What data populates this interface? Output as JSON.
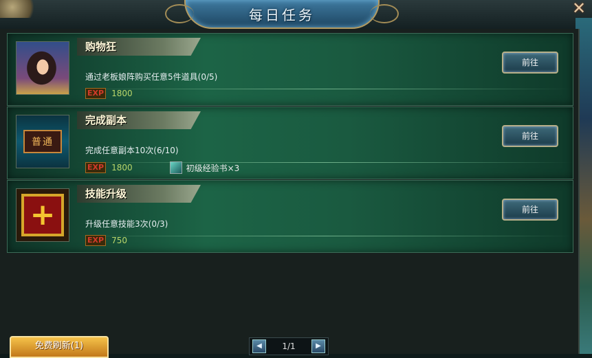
{
  "window": {
    "title": "每日任务",
    "close_glyph": "✕"
  },
  "tasks": [
    {
      "title": "购物狂",
      "description": "通过老板娘阵购买任意5件道具(0/5)",
      "exp_label": "EXP",
      "exp_value": "1800",
      "button": "前往",
      "icon": "portrait-icon"
    },
    {
      "title": "完成副本",
      "description": "完成任意副本10次(6/10)",
      "exp_label": "EXP",
      "exp_value": "1800",
      "item": "初级经验书×3",
      "button": "前往",
      "icon": "dungeon-icon",
      "icon_text": "普通"
    },
    {
      "title": "技能升级",
      "description": "升级任意技能3次(0/3)",
      "exp_label": "EXP",
      "exp_value": "750",
      "button": "前往",
      "icon": "skill-upgrade-icon"
    }
  ],
  "footer": {
    "refresh_button": "免费刷新(1)",
    "page": "1/1",
    "prev_glyph": "◀",
    "next_glyph": "▶"
  }
}
